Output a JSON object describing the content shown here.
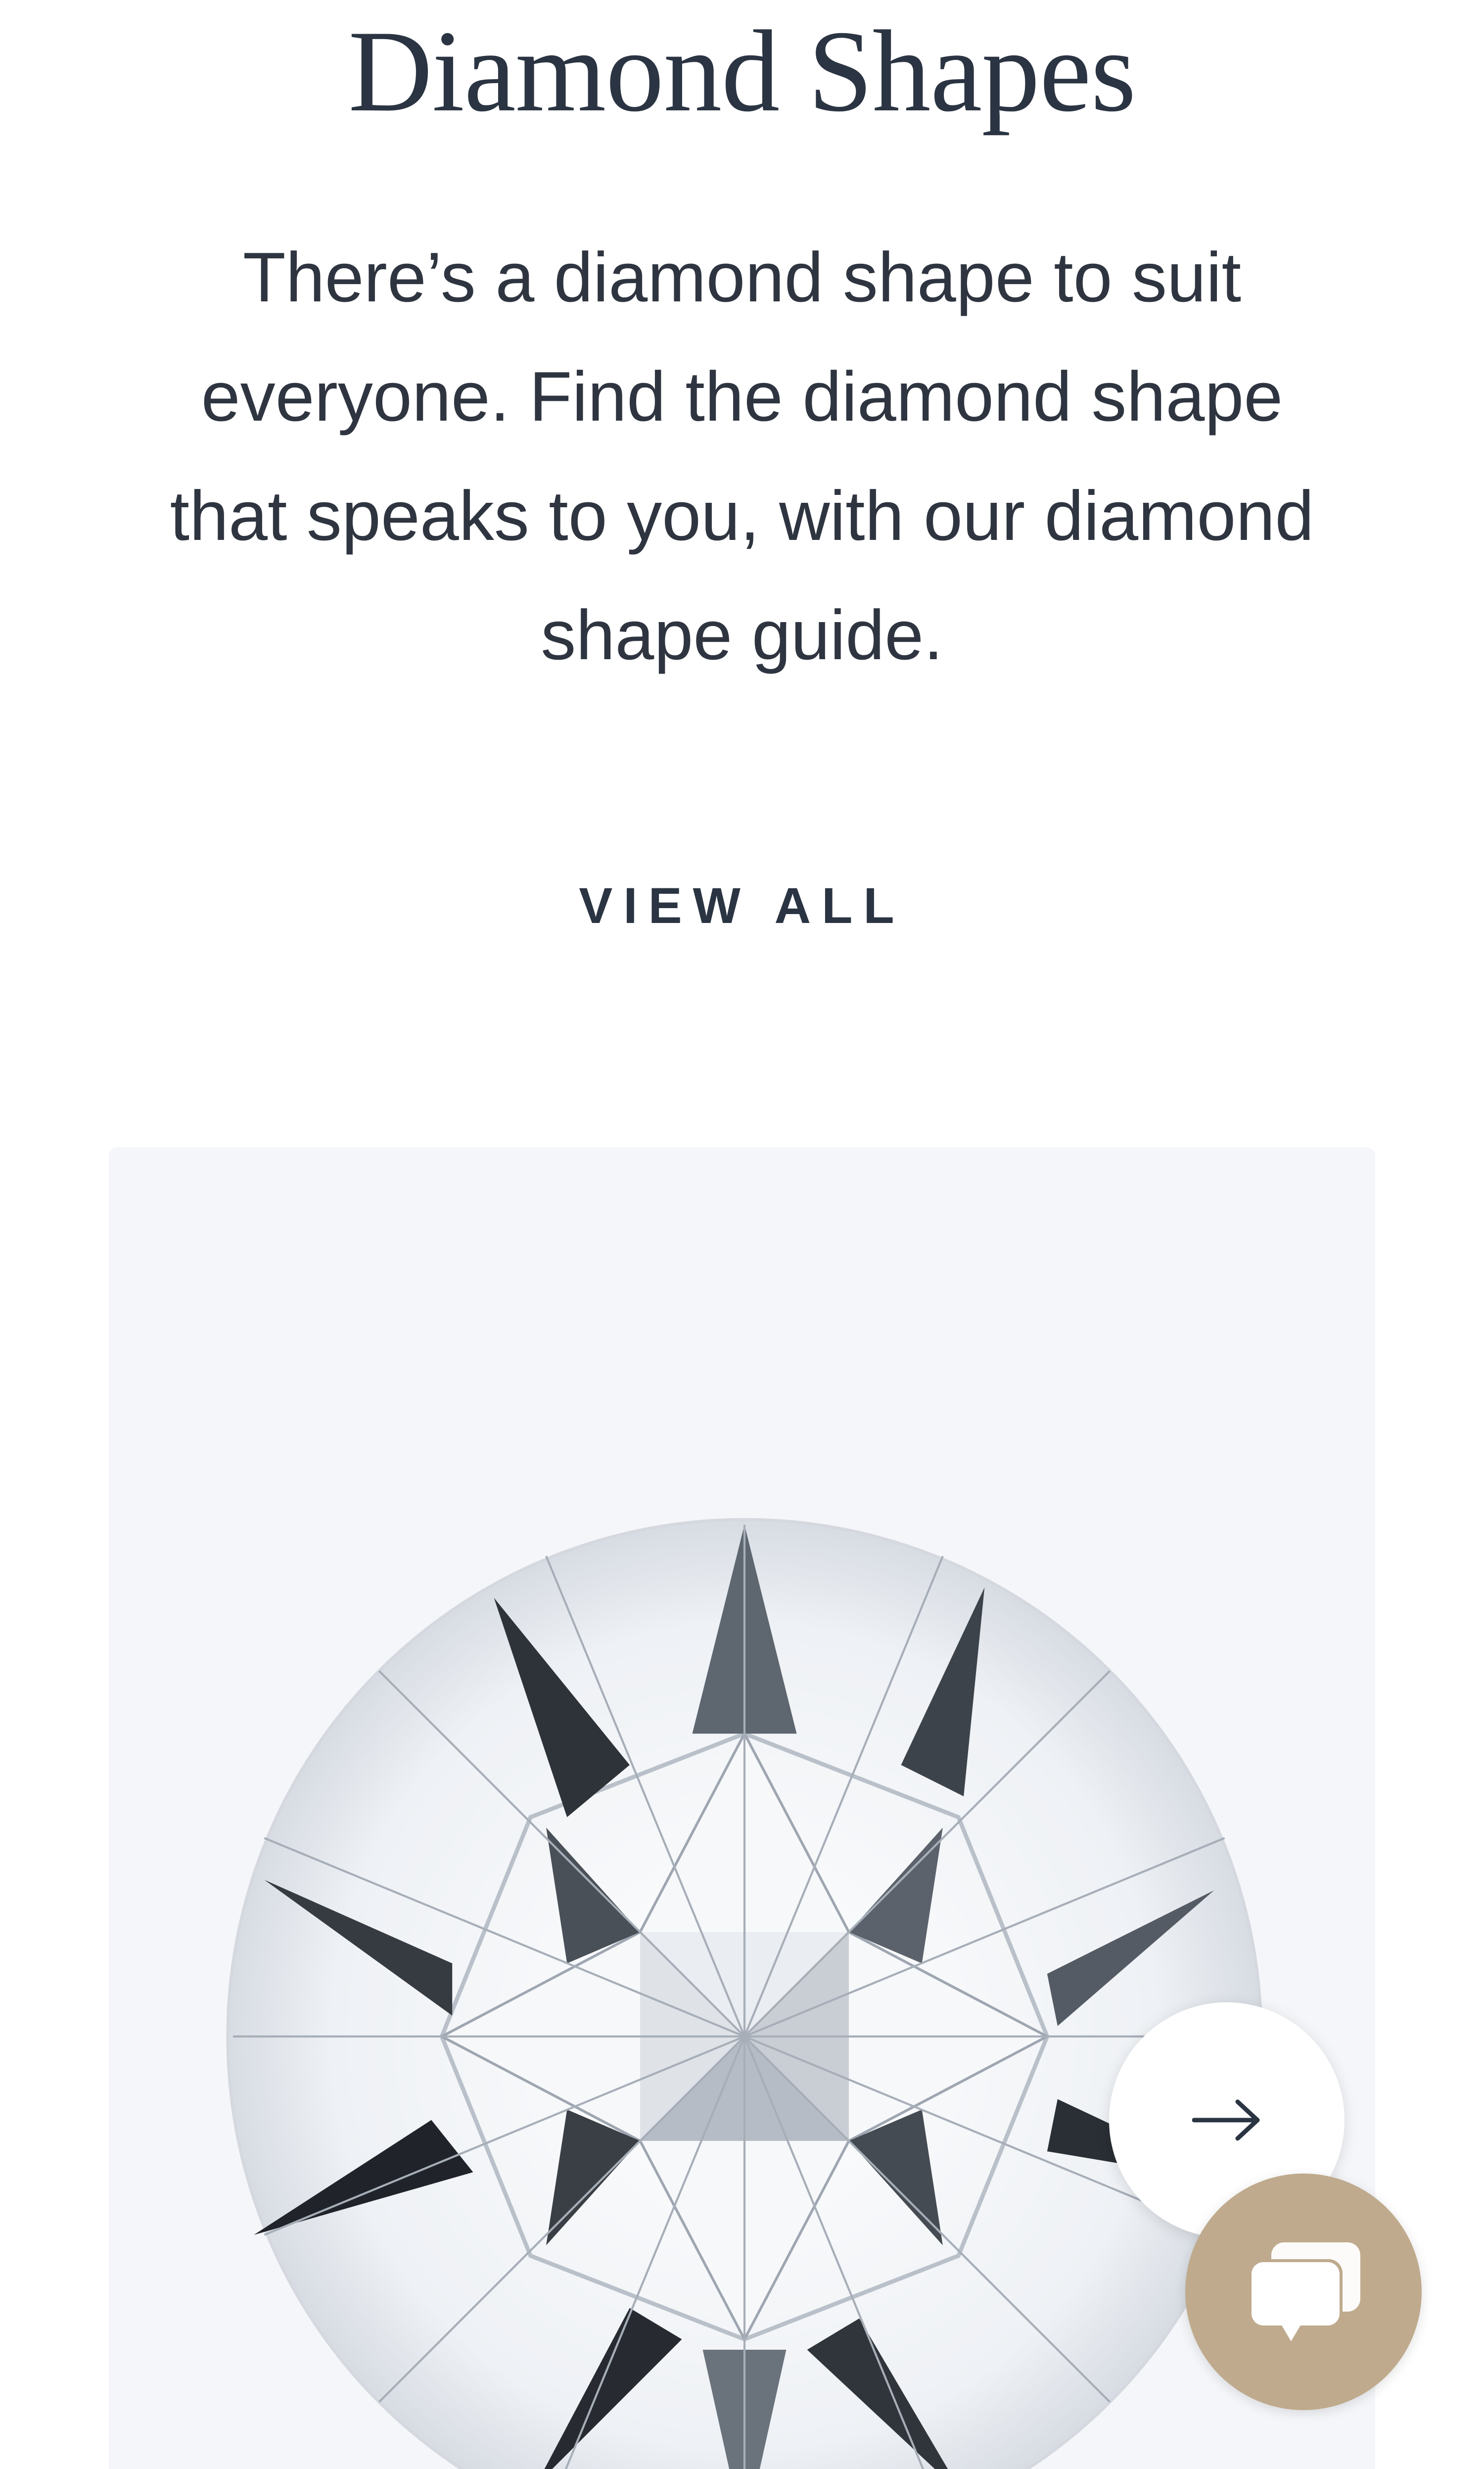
{
  "section": {
    "title": "Diamond Shapes",
    "intro": "There’s a diamond shape to suit everyone. Find the diamond shape that speaks to you, with our diamond shape guide.",
    "view_all_label": "VIEW ALL"
  },
  "carousel": {
    "current_item_icon": "round-diamond-image",
    "next_icon": "arrow-right-icon"
  },
  "chat_widget": {
    "icon": "chat-bubble-icon",
    "color": "#bfaa8d"
  },
  "colors": {
    "text": "#2b3442",
    "card_background": "#f4f6f9"
  }
}
